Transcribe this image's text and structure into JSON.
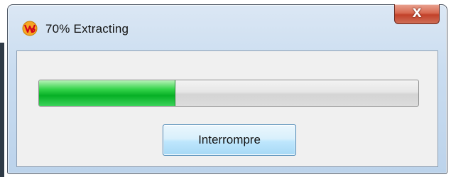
{
  "window": {
    "title": "70% Extracting",
    "icon": "app-logo-icon",
    "close_glyph": "X"
  },
  "progress": {
    "value_percent": 36,
    "fill_color": "#06b025"
  },
  "actions": {
    "interrupt_label": "Interrompre"
  },
  "colors": {
    "close_button": "#c2412a",
    "button_border": "#3c7fb1"
  }
}
